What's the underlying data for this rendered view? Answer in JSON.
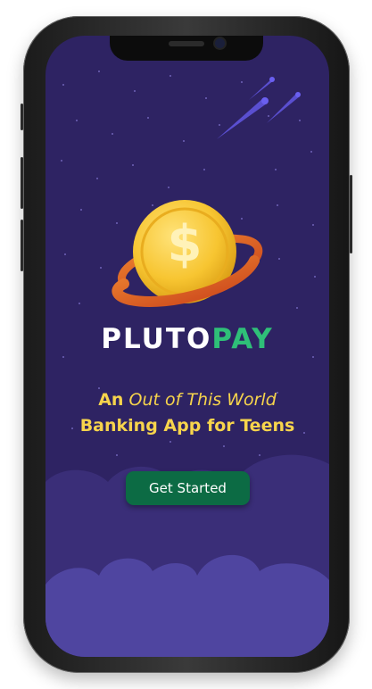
{
  "app": {
    "wordmark_primary": "PLUTO",
    "wordmark_accent": "PAY"
  },
  "tagline": {
    "line1_bold": "An",
    "line1_italic": "Out of This World",
    "line2": "Banking App for Teens"
  },
  "cta": {
    "label": "Get Started"
  },
  "logo": {
    "coin_symbol": "$"
  },
  "icons": [
    "planet-coin-logo-icon",
    "shooting-star-icon"
  ],
  "colors": {
    "background": "#2e2363",
    "cloud_back": "#3a2e78",
    "cloud_front": "#4f45a0",
    "tagline_yellow": "#f7d44c",
    "accent_green": "#2fbf78",
    "button_green": "#0c6b44",
    "coin_gold": "#f7c531",
    "ring_orange": "#e56a25"
  }
}
